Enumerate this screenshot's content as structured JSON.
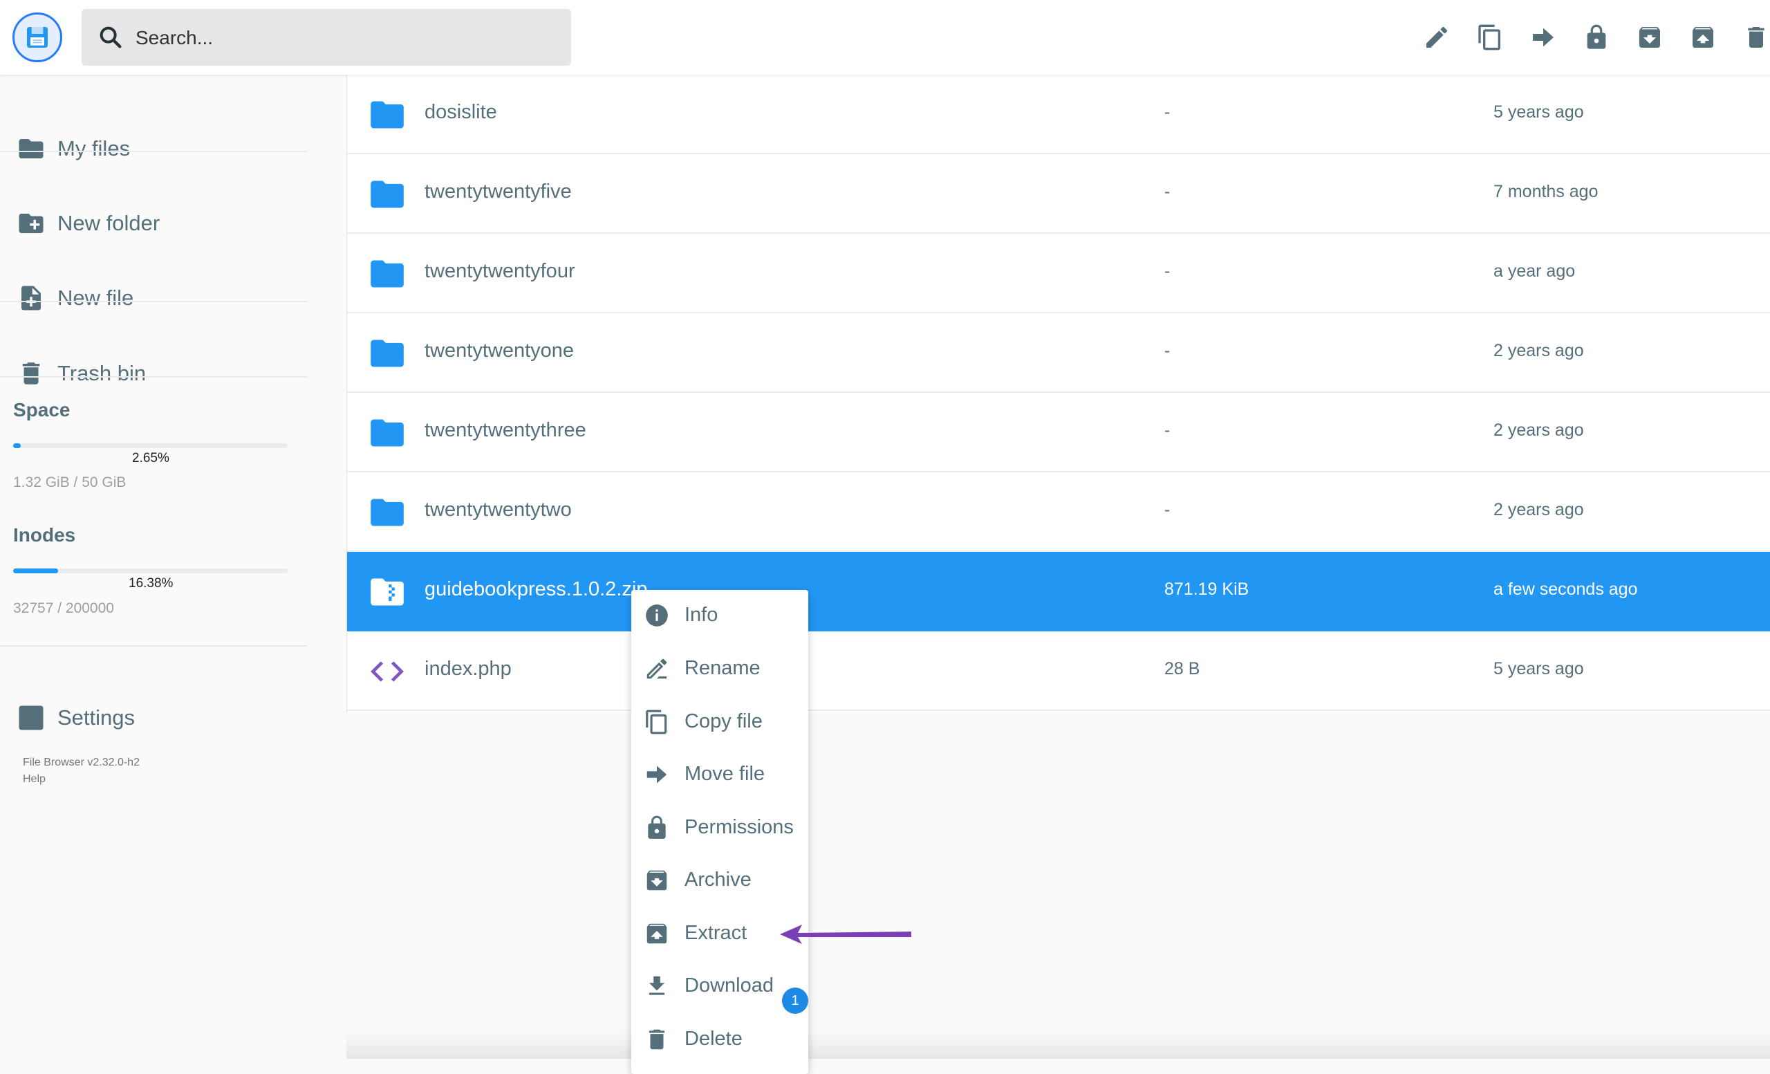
{
  "search": {
    "placeholder": "Search..."
  },
  "toolbar": {
    "icons": [
      "pencil-icon",
      "copy-icon",
      "arrow-right-icon",
      "lock-icon",
      "archive-icon",
      "unarchive-icon",
      "trash-icon"
    ]
  },
  "sidebar": {
    "items": [
      {
        "label": "My files",
        "icon": "folder-icon"
      },
      {
        "label": "New folder",
        "icon": "folder-plus-icon"
      },
      {
        "label": "New file",
        "icon": "file-plus-icon"
      },
      {
        "label": "Trash bin",
        "icon": "trash-icon"
      }
    ],
    "space": {
      "title": "Space",
      "percent_label": "2.65%",
      "percent": 2.65,
      "usage": "1.32 GiB / 50 GiB"
    },
    "inodes": {
      "title": "Inodes",
      "percent_label": "16.38%",
      "percent": 16.38,
      "usage": "32757 / 200000"
    },
    "settings": {
      "label": "Settings",
      "icon": "gear-icon"
    },
    "version": "File Browser v2.32.0-h2",
    "help": "Help"
  },
  "files": [
    {
      "name": "dosislite",
      "size": "-",
      "modified": "5 years ago",
      "type": "folder"
    },
    {
      "name": "twentytwentyfive",
      "size": "-",
      "modified": "7 months ago",
      "type": "folder"
    },
    {
      "name": "twentytwentyfour",
      "size": "-",
      "modified": "a year ago",
      "type": "folder"
    },
    {
      "name": "twentytwentyone",
      "size": "-",
      "modified": "2 years ago",
      "type": "folder"
    },
    {
      "name": "twentytwentythree",
      "size": "-",
      "modified": "2 years ago",
      "type": "folder"
    },
    {
      "name": "twentytwentytwo",
      "size": "-",
      "modified": "2 years ago",
      "type": "folder"
    },
    {
      "name": "guidebookpress.1.0.2.zip",
      "size": "871.19 KiB",
      "modified": "a few seconds ago",
      "type": "zip",
      "selected": true
    },
    {
      "name": "index.php",
      "size": "28 B",
      "modified": "5 years ago",
      "type": "code"
    }
  ],
  "context_menu": {
    "items": [
      {
        "label": "Info",
        "icon": "info-icon"
      },
      {
        "label": "Rename",
        "icon": "rename-icon"
      },
      {
        "label": "Copy file",
        "icon": "copy-icon"
      },
      {
        "label": "Move file",
        "icon": "arrow-right-icon"
      },
      {
        "label": "Permissions",
        "icon": "lock-icon"
      },
      {
        "label": "Archive",
        "icon": "archive-icon"
      },
      {
        "label": "Extract",
        "icon": "unarchive-icon"
      },
      {
        "label": "Download",
        "icon": "download-icon"
      },
      {
        "label": "Delete",
        "icon": "trash-icon"
      }
    ],
    "download_badge": "1"
  },
  "colors": {
    "accent": "#2196f3",
    "annotation_arrow": "#7b3fb5"
  }
}
